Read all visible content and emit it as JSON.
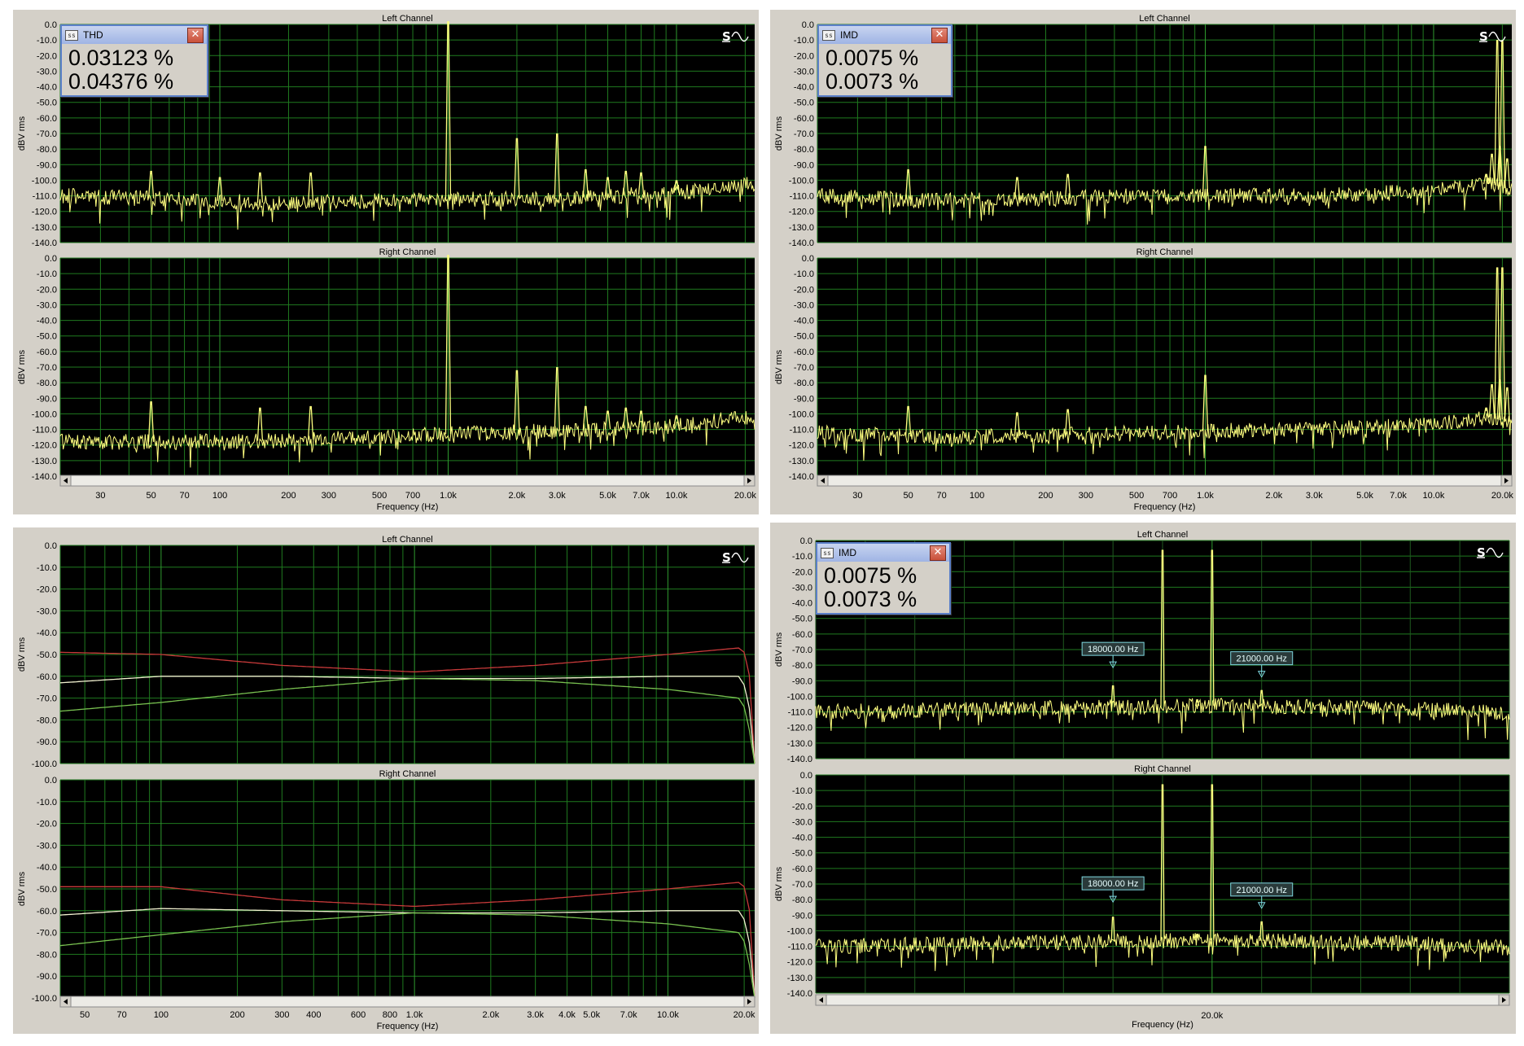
{
  "chart_data": [
    {
      "type": "line",
      "xscale": "log",
      "xlim": [
        20,
        22000
      ],
      "ylim": [
        -140,
        0
      ],
      "xlabel": "Frequency (Hz)",
      "ylabel": "dBV rms",
      "yticks": [
        "0.0",
        "-10.0",
        "-20.0",
        "-30.0",
        "-40.0",
        "-50.0",
        "-60.0",
        "-70.0",
        "-80.0",
        "-90.0",
        "-100.0",
        "-110.0",
        "-120.0",
        "-130.0",
        "-140.0"
      ],
      "xticks": [
        "30",
        "50",
        "70",
        "100",
        "200",
        "300",
        "500",
        "700",
        "1.0k",
        "2.0k",
        "3.0k",
        "5.0k",
        "7.0k",
        "10.0k",
        "20.0k"
      ],
      "readout": {
        "name": "THD",
        "values": [
          "0.03123 %",
          "0.04376 %"
        ]
      },
      "channels": [
        {
          "title": "Left Channel",
          "color": "#ffff80",
          "floor": [
            [
              20,
              -110
            ],
            [
              60,
              -112
            ],
            [
              200,
              -115
            ],
            [
              500,
              -113
            ],
            [
              1000,
              -112
            ],
            [
              3000,
              -112
            ],
            [
              10000,
              -108
            ],
            [
              20000,
              -102
            ],
            [
              22000,
              -106
            ]
          ],
          "peaks": [
            [
              1000,
              0
            ],
            [
              2000,
              -75
            ],
            [
              3000,
              -72
            ],
            [
              4000,
              -95
            ],
            [
              5000,
              -100
            ],
            [
              6000,
              -96
            ],
            [
              7000,
              -97
            ],
            [
              10000,
              -102
            ],
            [
              50,
              -96
            ],
            [
              150,
              -97
            ],
            [
              100,
              -100
            ],
            [
              250,
              -97
            ]
          ]
        },
        {
          "title": "Right Channel",
          "color": "#ffff80",
          "floor": [
            [
              20,
              -118
            ],
            [
              60,
              -118
            ],
            [
              200,
              -117
            ],
            [
              500,
              -115
            ],
            [
              1000,
              -113
            ],
            [
              3000,
              -111
            ],
            [
              10000,
              -108
            ],
            [
              20000,
              -102
            ],
            [
              22000,
              -106
            ]
          ],
          "peaks": [
            [
              1000,
              0
            ],
            [
              2000,
              -74
            ],
            [
              3000,
              -72
            ],
            [
              4000,
              -97
            ],
            [
              5000,
              -100
            ],
            [
              6000,
              -98
            ],
            [
              7000,
              -100
            ],
            [
              10000,
              -103
            ],
            [
              50,
              -94
            ],
            [
              150,
              -98
            ],
            [
              250,
              -97
            ]
          ]
        }
      ]
    },
    {
      "type": "line",
      "xscale": "log",
      "xlim": [
        20,
        22000
      ],
      "ylim": [
        -140,
        0
      ],
      "xlabel": "Frequency (Hz)",
      "ylabel": "dBV rms",
      "yticks": [
        "0.0",
        "-10.0",
        "-20.0",
        "-30.0",
        "-40.0",
        "-50.0",
        "-60.0",
        "-70.0",
        "-80.0",
        "-90.0",
        "-100.0",
        "-110.0",
        "-120.0",
        "-130.0",
        "-140.0"
      ],
      "xticks": [
        "30",
        "50",
        "70",
        "100",
        "200",
        "300",
        "500",
        "700",
        "1.0k",
        "2.0k",
        "3.0k",
        "5.0k",
        "7.0k",
        "10.0k",
        "20.0k"
      ],
      "readout": {
        "name": "IMD",
        "values": [
          "0.0075 %",
          "0.0073 %"
        ]
      },
      "channels": [
        {
          "title": "Left Channel",
          "color": "#ffff80",
          "floor": [
            [
              20,
              -110
            ],
            [
              60,
              -113
            ],
            [
              200,
              -112
            ],
            [
              500,
              -110
            ],
            [
              1000,
              -110
            ],
            [
              3000,
              -110
            ],
            [
              10000,
              -107
            ],
            [
              18000,
              -102
            ],
            [
              22000,
              -106
            ]
          ],
          "peaks": [
            [
              1000,
              -80
            ],
            [
              50,
              -95
            ],
            [
              150,
              -100
            ],
            [
              250,
              -98
            ],
            [
              17000,
              -98
            ],
            [
              18000,
              -85
            ],
            [
              19000,
              -12
            ],
            [
              19500,
              -80
            ],
            [
              20000,
              -12
            ],
            [
              21000,
              -88
            ]
          ]
        },
        {
          "title": "Right Channel",
          "color": "#ffff80",
          "floor": [
            [
              20,
              -112
            ],
            [
              60,
              -115
            ],
            [
              200,
              -114
            ],
            [
              500,
              -112
            ],
            [
              1000,
              -111
            ],
            [
              3000,
              -110
            ],
            [
              10000,
              -107
            ],
            [
              18000,
              -102
            ],
            [
              22000,
              -106
            ]
          ],
          "peaks": [
            [
              1000,
              -77
            ],
            [
              50,
              -97
            ],
            [
              150,
              -101
            ],
            [
              250,
              -99
            ],
            [
              17000,
              -98
            ],
            [
              18000,
              -83
            ],
            [
              19000,
              -8
            ],
            [
              19500,
              -80
            ],
            [
              20000,
              -8
            ],
            [
              21000,
              -85
            ]
          ]
        }
      ]
    },
    {
      "type": "line",
      "xscale": "log",
      "xlim": [
        40,
        22000
      ],
      "ylim": [
        -100,
        0
      ],
      "xlabel": "Frequency (Hz)",
      "ylabel": "dBV rms",
      "yticks": [
        "0.0",
        "-10.0",
        "-20.0",
        "-30.0",
        "-40.0",
        "-50.0",
        "-60.0",
        "-70.0",
        "-80.0",
        "-90.0",
        "-100.0"
      ],
      "xticks": [
        "50",
        "70",
        "100",
        "200",
        "300",
        "400",
        "600",
        "800",
        "1.0k",
        "2.0k",
        "3.0k",
        "4.0k",
        "5.0k",
        "7.0k",
        "10.0k",
        "20.0k"
      ],
      "channels": [
        {
          "title": "Left Channel",
          "series": [
            {
              "color": "#c83a3a",
              "points": [
                [
                  40,
                  -49
                ],
                [
                  100,
                  -50
                ],
                [
                  300,
                  -55
                ],
                [
                  1000,
                  -58
                ],
                [
                  3000,
                  -55
                ],
                [
                  10000,
                  -50
                ],
                [
                  19000,
                  -47
                ],
                [
                  20000,
                  -49
                ],
                [
                  21000,
                  -60
                ],
                [
                  22000,
                  -100
                ]
              ]
            },
            {
              "color": "#f2f2d0",
              "points": [
                [
                  40,
                  -63
                ],
                [
                  100,
                  -60
                ],
                [
                  300,
                  -60
                ],
                [
                  1000,
                  -61
                ],
                [
                  3000,
                  -61
                ],
                [
                  10000,
                  -60
                ],
                [
                  19000,
                  -60
                ],
                [
                  20000,
                  -64
                ],
                [
                  21000,
                  -75
                ],
                [
                  22000,
                  -100
                ]
              ]
            },
            {
              "color": "#78c050",
              "points": [
                [
                  40,
                  -76
                ],
                [
                  100,
                  -72
                ],
                [
                  300,
                  -66
                ],
                [
                  1000,
                  -61
                ],
                [
                  3000,
                  -62
                ],
                [
                  10000,
                  -66
                ],
                [
                  19000,
                  -70
                ],
                [
                  20000,
                  -74
                ],
                [
                  21000,
                  -85
                ],
                [
                  22000,
                  -100
                ]
              ]
            }
          ]
        },
        {
          "title": "Right Channel",
          "series": [
            {
              "color": "#c83a3a",
              "points": [
                [
                  40,
                  -49
                ],
                [
                  100,
                  -49
                ],
                [
                  300,
                  -55
                ],
                [
                  1000,
                  -58
                ],
                [
                  3000,
                  -55
                ],
                [
                  10000,
                  -50
                ],
                [
                  19000,
                  -47
                ],
                [
                  20000,
                  -49
                ],
                [
                  21000,
                  -60
                ],
                [
                  22000,
                  -100
                ]
              ]
            },
            {
              "color": "#f2f2d0",
              "points": [
                [
                  40,
                  -62
                ],
                [
                  100,
                  -59
                ],
                [
                  300,
                  -60
                ],
                [
                  1000,
                  -61
                ],
                [
                  3000,
                  -61
                ],
                [
                  10000,
                  -60
                ],
                [
                  19000,
                  -60
                ],
                [
                  20000,
                  -64
                ],
                [
                  21000,
                  -75
                ],
                [
                  22000,
                  -100
                ]
              ]
            },
            {
              "color": "#78c050",
              "points": [
                [
                  40,
                  -76
                ],
                [
                  100,
                  -71
                ],
                [
                  300,
                  -65
                ],
                [
                  1000,
                  -61
                ],
                [
                  3000,
                  -62
                ],
                [
                  10000,
                  -66
                ],
                [
                  19000,
                  -70
                ],
                [
                  20000,
                  -74
                ],
                [
                  21000,
                  -85
                ],
                [
                  22000,
                  -100
                ]
              ]
            }
          ]
        }
      ]
    },
    {
      "type": "line",
      "xscale": "linear",
      "xlim": [
        12000,
        26000
      ],
      "ylim": [
        -140,
        0
      ],
      "xlabel": "Frequency (Hz)",
      "ylabel": "dBV rms",
      "yticks": [
        "0.0",
        "-10.0",
        "-20.0",
        "-30.0",
        "-40.0",
        "-50.0",
        "-60.0",
        "-70.0",
        "-80.0",
        "-90.0",
        "-100.0",
        "-110.0",
        "-120.0",
        "-130.0",
        "-140.0"
      ],
      "xticks": [
        "20.0k"
      ],
      "readout": {
        "name": "IMD",
        "values": [
          "0.0075 %",
          "0.0073 %"
        ]
      },
      "channels": [
        {
          "title": "Left Channel",
          "color": "#ffff80",
          "floor": [
            [
              12000,
              -110
            ],
            [
              16000,
              -108
            ],
            [
              20000,
              -106
            ],
            [
              24000,
              -108
            ],
            [
              26000,
              -111
            ]
          ],
          "peaks": [
            [
              18000,
              -95
            ],
            [
              19000,
              -8
            ],
            [
              20000,
              -8
            ],
            [
              21000,
              -98
            ],
            [
              19700,
              -104
            ]
          ],
          "markers": [
            {
              "x": 18000,
              "y": -80,
              "label": "18000.00 Hz"
            },
            {
              "x": 21000,
              "y": -86,
              "label": "21000.00 Hz"
            }
          ]
        },
        {
          "title": "Right Channel",
          "color": "#ffff80",
          "floor": [
            [
              12000,
              -110
            ],
            [
              16000,
              -108
            ],
            [
              20000,
              -106
            ],
            [
              24000,
              -108
            ],
            [
              26000,
              -111
            ]
          ],
          "peaks": [
            [
              18000,
              -93
            ],
            [
              19000,
              -8
            ],
            [
              20000,
              -8
            ],
            [
              21000,
              -96
            ],
            [
              19700,
              -104
            ]
          ],
          "markers": [
            {
              "x": 18000,
              "y": -80,
              "label": "18000.00 Hz"
            },
            {
              "x": 21000,
              "y": -84,
              "label": "21000.00 Hz"
            }
          ]
        }
      ]
    }
  ]
}
